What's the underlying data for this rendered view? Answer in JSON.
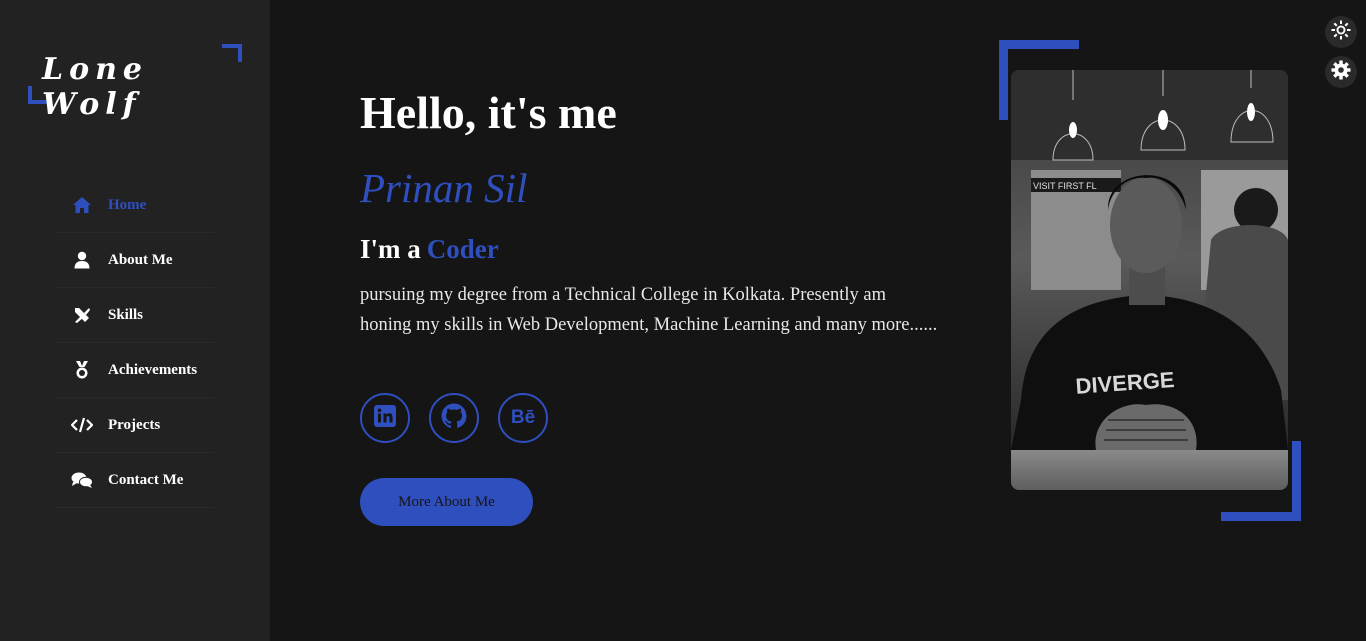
{
  "logo": {
    "text": "Lone Wolf"
  },
  "nav": {
    "items": [
      {
        "label": "Home",
        "icon": "home-icon",
        "active": true
      },
      {
        "label": "About Me",
        "icon": "user-icon"
      },
      {
        "label": "Skills",
        "icon": "tools-icon"
      },
      {
        "label": "Achievements",
        "icon": "medal-icon"
      },
      {
        "label": "Projects",
        "icon": "code-icon"
      },
      {
        "label": "Contact Me",
        "icon": "comments-icon"
      }
    ]
  },
  "hero": {
    "greeting": "Hello, it's me",
    "name": "Prinan Sil",
    "role_prefix": "I'm a",
    "role_word": "Coder",
    "description": "pursuing my degree from a Technical College in Kolkata. Presently am honing my skills in Web Development, Machine Learning and many more......",
    "more_button": "More About Me"
  },
  "socials": [
    {
      "name": "linkedin",
      "icon": "linkedin-icon"
    },
    {
      "name": "github",
      "icon": "github-icon"
    },
    {
      "name": "behance",
      "icon": "behance-icon",
      "text": "Bē"
    }
  ],
  "photo": {
    "sign_text": "VISIT FIRST FL",
    "shirt_text": "DIVERGE"
  },
  "colors": {
    "accent": "#2f4fbf",
    "background": "#151515",
    "sidebar": "#222222"
  }
}
